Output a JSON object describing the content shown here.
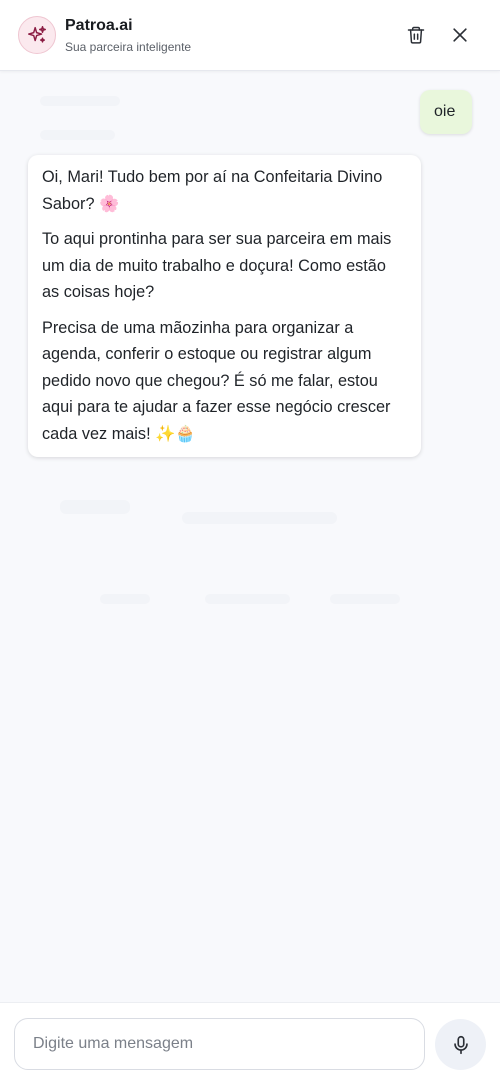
{
  "header": {
    "title": "Patroa.ai",
    "subtitle": "Sua parceira inteligente",
    "icons": {
      "avatar": "sparkles-icon",
      "trash": "trash-icon",
      "close": "close-icon"
    }
  },
  "messages": [
    {
      "role": "user",
      "text": "oie"
    },
    {
      "role": "assistant",
      "paragraphs": [
        "Oi, Mari! Tudo bem por aí na Confeitaria Divino Sabor? 🌸",
        "To aqui prontinha para ser sua parceira em mais um dia de muito trabalho e doçura! Como estão as coisas hoje?",
        "Precisa de uma mãozinha para organizar a agenda, conferir o estoque ou registrar algum pedido novo que chegou? É só me falar, estou aqui para te ajudar a fazer esse negócio crescer cada vez mais! ✨🧁"
      ]
    }
  ],
  "composer": {
    "placeholder": "Digite uma mensagem",
    "value": "",
    "mic_icon": "microphone-icon"
  },
  "colors": {
    "accent": "#8b1c43",
    "user_bubble": "#e9f7dc",
    "background": "#f8f9fc"
  }
}
